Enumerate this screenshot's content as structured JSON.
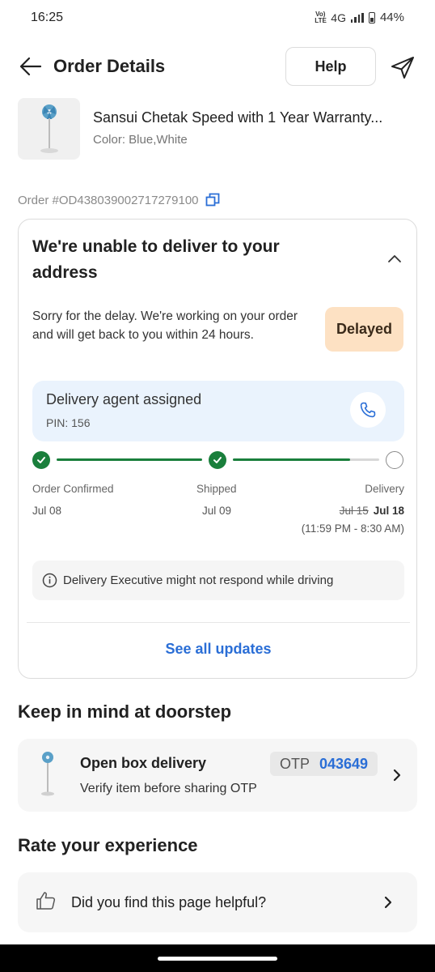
{
  "status_bar": {
    "time": "16:25",
    "network_small": "Vo)\nLTE",
    "network": "4G",
    "battery": "44%"
  },
  "header": {
    "title": "Order Details",
    "help_label": "Help"
  },
  "product": {
    "name": "Sansui Chetak Speed with 1 Year Warranty...",
    "color": "Color: Blue,White"
  },
  "order": {
    "id": "Order #OD438039002717279100"
  },
  "delivery_card": {
    "title": "We're unable to deliver to your address",
    "message": "Sorry for the delay. We're working on your order and will get back to you within 24 hours.",
    "badge": "Delayed",
    "agent_title": "Delivery agent assigned",
    "agent_pin": "PIN: 156",
    "steps": [
      {
        "label": "Order Confirmed",
        "date": "Jul 08",
        "done": true
      },
      {
        "label": "Shipped",
        "date": "Jul 09",
        "done": true
      },
      {
        "label": "Delivery",
        "old_date": "Jul 15",
        "date": "Jul 18",
        "window": "(11:59 PM - 8:30 AM)",
        "done": false
      }
    ],
    "progress_second_segment": 0.8,
    "info": "Delivery Executive might not respond while driving",
    "see_all": "See all updates"
  },
  "doorstep": {
    "section_title": "Keep in mind at doorstep",
    "title": "Open box delivery",
    "subtitle": "Verify item before sharing OTP",
    "otp_label": "OTP",
    "otp_value": "043649"
  },
  "rating": {
    "section_title": "Rate your experience",
    "question": "Did you find this page helpful?"
  },
  "colors": {
    "accent": "#2a6ed6",
    "success": "#1a7f3c",
    "delayed_bg": "#fde1c3",
    "agent_bg": "#eaf3fd"
  },
  "icons": [
    "back-arrow-icon",
    "send-icon",
    "copy-icon",
    "chevron-up-icon",
    "phone-icon",
    "check-icon",
    "info-icon",
    "chevron-right-icon",
    "thumbs-up-icon"
  ]
}
